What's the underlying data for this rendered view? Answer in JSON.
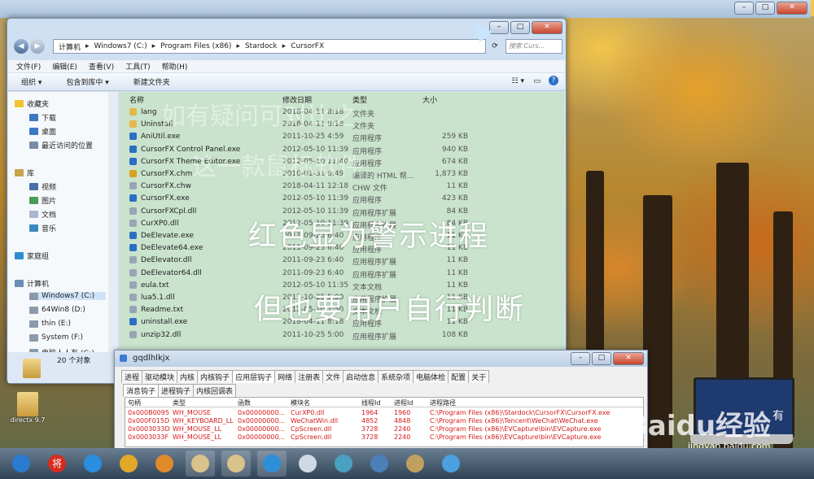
{
  "desktop": {
    "icon_label": "directx 9.7",
    "watermark_url": "jingyan.baidu.com",
    "baidu_logo": "Baidu经验",
    "laptop_text": "有"
  },
  "explorer": {
    "address": [
      "计算机",
      "Windows7 (C:)",
      "Program Files (x86)",
      "Stardock",
      "CursorFX"
    ],
    "search_placeholder": "搜索 Curs...",
    "menu": [
      "文件(F)",
      "编辑(E)",
      "查看(V)",
      "工具(T)",
      "帮助(H)"
    ],
    "toolbar": [
      "组织 ▾",
      "包含到库中 ▾",
      "新建文件夹"
    ],
    "nav": [
      {
        "label": "收藏夹",
        "icon": "star-icon"
      },
      {
        "label": "下载",
        "icon": "download-folder-icon"
      },
      {
        "label": "桌面",
        "icon": "desktop-icon"
      },
      {
        "label": "最近访问的位置",
        "icon": "recent-places-icon"
      },
      {
        "label": "库",
        "icon": "library-icon"
      },
      {
        "label": "视频",
        "icon": "video-icon"
      },
      {
        "label": "图片",
        "icon": "picture-icon"
      },
      {
        "label": "文档",
        "icon": "document-icon"
      },
      {
        "label": "音乐",
        "icon": "music-icon"
      },
      {
        "label": "家庭组",
        "icon": "homegroup-icon"
      },
      {
        "label": "计算机",
        "icon": "computer-icon"
      },
      {
        "label": "Windows7 (C:)",
        "icon": "drive-icon"
      },
      {
        "label": "64Win8 (D:)",
        "icon": "drive-icon"
      },
      {
        "label": "thin (E:)",
        "icon": "drive-icon"
      },
      {
        "label": "System (F:)",
        "icon": "drive-icon"
      },
      {
        "label": "电脑人人有 (G:)",
        "icon": "drive-icon"
      }
    ],
    "columns": [
      "名称",
      "修改日期",
      "类型",
      "大小"
    ],
    "files": [
      {
        "name": "lang",
        "date": "2018-04-11 8:18",
        "type": "文件夹",
        "size": ""
      },
      {
        "name": "Uninstall",
        "date": "2018-04-11 8:18",
        "type": "文件夹",
        "size": ""
      },
      {
        "name": "AniUtil.exe",
        "date": "2011-10-25 4:59",
        "type": "应用程序",
        "size": "259 KB"
      },
      {
        "name": "CursorFX Control Panel.exe",
        "date": "2012-05-10 11:39",
        "type": "应用程序",
        "size": "940 KB"
      },
      {
        "name": "CursorFX Theme Editor.exe",
        "date": "2012-05-10 11:40",
        "type": "应用程序",
        "size": "674 KB"
      },
      {
        "name": "CursorFX.chm",
        "date": "2010-01-31 6:49",
        "type": "编译的 HTML 帮...",
        "size": "1,873 KB"
      },
      {
        "name": "CursorFX.chw",
        "date": "2018-04-11 12:18",
        "type": "CHW 文件",
        "size": "11 KB"
      },
      {
        "name": "CursorFX.exe",
        "date": "2012-05-10 11:39",
        "type": "应用程序",
        "size": "423 KB"
      },
      {
        "name": "CursorFXCpl.dll",
        "date": "2012-05-10 11:39",
        "type": "应用程序扩展",
        "size": "84 KB"
      },
      {
        "name": "CurXP0.dll",
        "date": "2012-05-10 11:39",
        "type": "应用程序扩展",
        "size": "84 KB"
      },
      {
        "name": "DeElevate.exe",
        "date": "2011-09-23 6:40",
        "type": "应用程序",
        "size": "11 KB"
      },
      {
        "name": "DeElevate64.exe",
        "date": "2011-09-23 6:40",
        "type": "应用程序",
        "size": "11 KB"
      },
      {
        "name": "DeElevator.dll",
        "date": "2011-09-23 6:40",
        "type": "应用程序扩展",
        "size": "11 KB"
      },
      {
        "name": "DeElevator64.dll",
        "date": "2011-09-23 6:40",
        "type": "应用程序扩展",
        "size": "11 KB"
      },
      {
        "name": "eula.txt",
        "date": "2012-05-10 11:35",
        "type": "文本文档",
        "size": "11 KB"
      },
      {
        "name": "lua5.1.dll",
        "date": "2011-10-25 5:00",
        "type": "应用程序扩展",
        "size": "11 KB"
      },
      {
        "name": "Readme.txt",
        "date": "2012-05-10 1:50",
        "type": "文本文档",
        "size": "11 KB"
      },
      {
        "name": "uninstall.exe",
        "date": "2018-04-11 8:18",
        "type": "应用程序",
        "size": "11 KB"
      },
      {
        "name": "unzip32.dll",
        "date": "2011-10-25 5:00",
        "type": "应用程序扩展",
        "size": "108 KB"
      }
    ],
    "status": "20 个对象"
  },
  "overlay": {
    "watermark1": "如有疑问可对比之",
    "watermark2": "这一款鼠标软件",
    "text1": "红色显为警示进程",
    "text2": "但也要用户自行判断"
  },
  "gq": {
    "title": "gqdlhlkjx",
    "tabs": [
      "进程",
      "驱动模块",
      "内核",
      "内核钩子",
      "应用层钩子",
      "网络",
      "注册表",
      "文件",
      "启动信息",
      "系统杂项",
      "电脑体检",
      "配置",
      "关于"
    ],
    "subtabs": [
      "消息钩子",
      "进程钩子",
      "内核回调表"
    ],
    "columns": [
      "句柄",
      "类型",
      "函数",
      "模块名",
      "线程Id",
      "进程Id",
      "进程路径"
    ],
    "rows": [
      [
        "0x000B0095",
        "WH_MOUSE",
        "0x00000000...",
        "CurXP0.dll",
        "1964",
        "1960",
        "C:\\Program Files (x86)\\Stardock\\CursorFX\\CursorFX.exe"
      ],
      [
        "0x000F015D",
        "WH_KEYBOARD_LL",
        "0x00000000...",
        "WeChatWin.dll",
        "4852",
        "4848",
        "C:\\Program Files (x86)\\Tencent\\WeChat\\WeChat.exe"
      ],
      [
        "0x0003033D",
        "WH_MOUSE_LL",
        "0x00000000...",
        "CpScreen.dll",
        "3728",
        "2240",
        "C:\\Program Files (x86)\\EVCapture\\bin\\EVCapture.exe"
      ],
      [
        "0x0003033F",
        "WH_MOUSE_LL",
        "0x00000000...",
        "CpScreen.dll",
        "3728",
        "2240",
        "C:\\Program Files (x86)\\EVCapture\\bin\\EVCapture.exe"
      ]
    ],
    "warning_color": "#d81a1a"
  },
  "taskbar": {
    "items": [
      "start-orb-icon",
      "antivirus-icon",
      "ie-icon",
      "chrome-icon",
      "media-player-icon",
      "explorer-icon",
      "folder-icon",
      "browser-icon",
      "document-icon",
      "fan-icon",
      "monitor-icon",
      "paint-icon",
      "network-icon"
    ],
    "av_glyph": "将"
  }
}
